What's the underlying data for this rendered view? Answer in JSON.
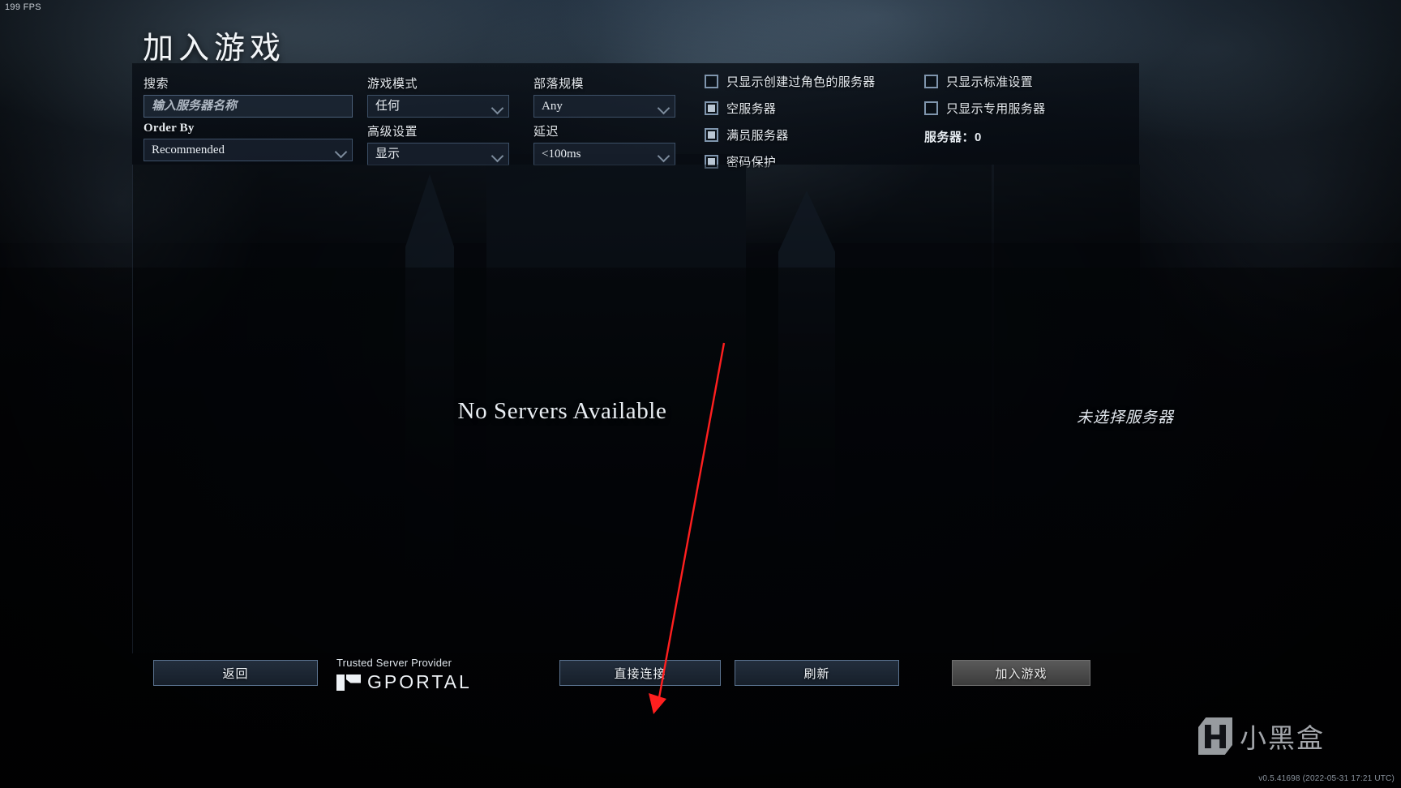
{
  "hud": {
    "fps": "199 FPS",
    "version": "v0.5.41698 (2022-05-31 17:21 UTC)"
  },
  "page": {
    "title": "加入游戏"
  },
  "filters": {
    "search": {
      "label": "搜索",
      "placeholder": "输入服务器名称",
      "value": ""
    },
    "order_by": {
      "label": "Order By",
      "value": "Recommended"
    },
    "game_mode": {
      "label": "游戏模式",
      "value": "任何"
    },
    "advanced": {
      "label": "高级设置",
      "value": "显示"
    },
    "clan_size": {
      "label": "部落规模",
      "value": "Any"
    },
    "latency": {
      "label": "延迟",
      "value": "<100ms"
    },
    "checkboxes_col1": [
      {
        "label": "只显示创建过角色的服务器",
        "checked": false
      },
      {
        "label": "空服务器",
        "checked": true
      },
      {
        "label": "满员服务器",
        "checked": true
      },
      {
        "label": "密码保护",
        "checked": true
      }
    ],
    "checkboxes_col2": [
      {
        "label": "只显示标准设置",
        "checked": false
      },
      {
        "label": "只显示专用服务器",
        "checked": false
      }
    ],
    "server_count": "服务器：0"
  },
  "main": {
    "empty_list_message": "No Servers Available",
    "no_selection_message": "未选择服务器"
  },
  "footer": {
    "back_button": "返回",
    "direct_connect_button": "直接连接",
    "refresh_button": "刷新",
    "join_button": "加入游戏",
    "provider_tagline": "Trusted Server Provider",
    "provider_name": "GPORTAL"
  },
  "watermark": {
    "text": "小黑盒"
  },
  "annotation": {
    "arrow_color": "#ff1f1f",
    "points_to": "直接连接"
  }
}
